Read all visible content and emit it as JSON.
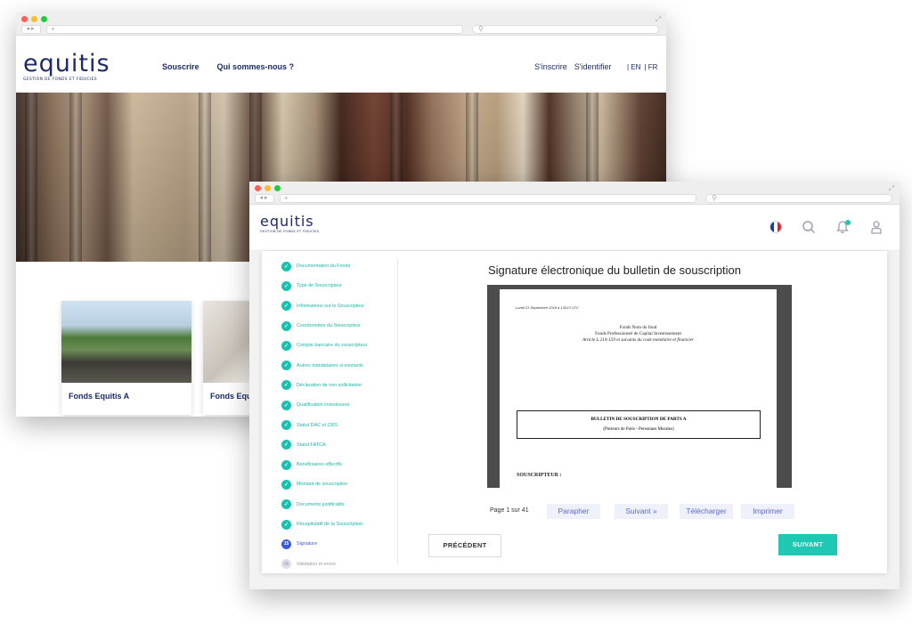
{
  "back_window": {
    "logo": {
      "word": "equitis",
      "tagline": "GESTION DE FONDS ET FIDUCIES"
    },
    "nav": [
      "Souscrire",
      "Qui sommes-nous ?"
    ],
    "auth": [
      "S'inscrire",
      "S'identifier"
    ],
    "lang": [
      "| EN",
      "| FR"
    ],
    "cards": [
      {
        "title": "Fonds Equitis A"
      },
      {
        "title": "Fonds Equ"
      }
    ]
  },
  "front_window": {
    "logo": {
      "word": "equitis",
      "tagline": "GESTION DE FONDS ET FIDUCIES"
    },
    "icons": [
      "france-flag-icon",
      "search-icon",
      "bell-icon",
      "user-icon"
    ],
    "steps": [
      {
        "label": "Documentation du Fonds",
        "state": "done"
      },
      {
        "label": "Type de Souscripteur",
        "state": "done"
      },
      {
        "label": "Informations sur le Souscripteur",
        "state": "done"
      },
      {
        "label": "Coordonnées du Souscripteur",
        "state": "done"
      },
      {
        "label": "Compte bancaire du souscripteur",
        "state": "done"
      },
      {
        "label": "Autres mandataires si existants",
        "state": "done"
      },
      {
        "label": "Déclaration de non sollicitation",
        "state": "done"
      },
      {
        "label": "Qualification investisseur",
        "state": "done"
      },
      {
        "label": "Statut DAC et CRS",
        "state": "done"
      },
      {
        "label": "Statut FATCA",
        "state": "done"
      },
      {
        "label": "Bénéficiaires effectifs",
        "state": "done"
      },
      {
        "label": "Montant de souscription",
        "state": "done"
      },
      {
        "label": "Documents justificatifs",
        "state": "done"
      },
      {
        "label": "Récapitulatif de la Souscription",
        "state": "done"
      },
      {
        "label": "Signature",
        "state": "current",
        "number": "15"
      },
      {
        "label": "Validation et envoi",
        "state": "todo",
        "number": "16"
      }
    ],
    "document": {
      "title": "Signature électronique du bulletin de souscription",
      "date": "Lundi 23 Septembre 2019 à 13h23 UTC",
      "line1": "Fonds  Nom du fond",
      "line2": "Fonds Professionnel de Capital Investissement",
      "line3": "Article L.214-159 et suivants du code monétaire et financier",
      "box_title": "BULLETIN DE SOUSCRIPTION DE PARTS A",
      "box_sub": "(Porteurs de Parts - Personnes Morales)",
      "section": "SOUSCRIPTEUR :"
    },
    "pager": "Page 1 sur 41",
    "tools": [
      "Parapher",
      "Suivant »",
      "Télécharger",
      "Imprimer"
    ],
    "prev_label": "PRÉCÉDENT",
    "next_label": "SUIVANT"
  },
  "colors": {
    "brand": "#1d2b66",
    "accent": "#1ec8b3",
    "current_step": "#3d5bd9"
  }
}
